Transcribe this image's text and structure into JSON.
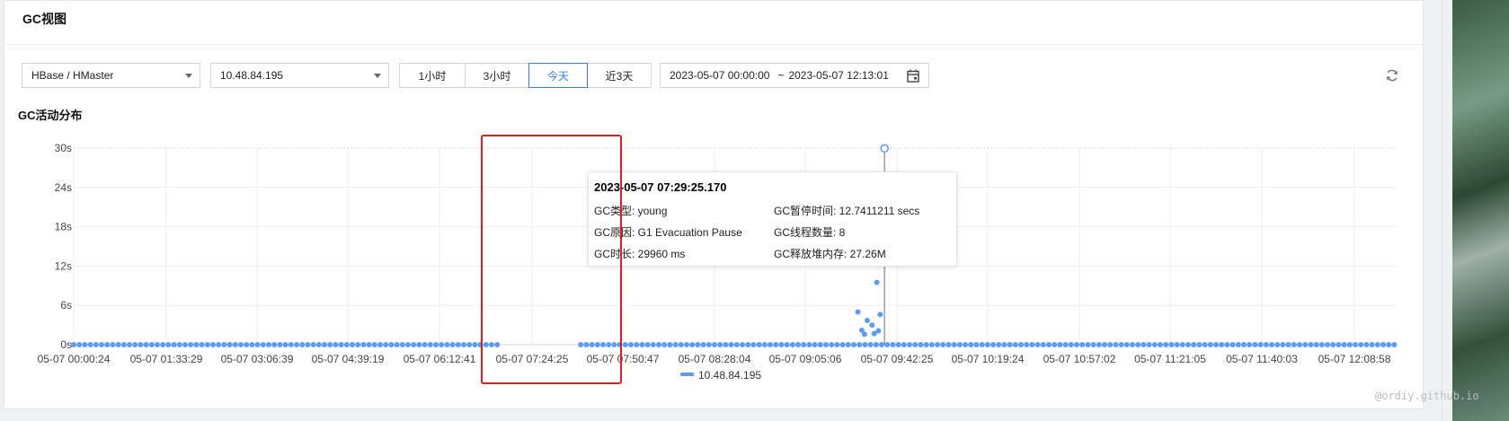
{
  "panel": {
    "title": "GC视图"
  },
  "filters": {
    "service": "HBase / HMaster",
    "instance": "10.48.84.195",
    "time_ranges": [
      {
        "label": "1小时",
        "active": false
      },
      {
        "label": "3小时",
        "active": false
      },
      {
        "label": "今天",
        "active": true
      },
      {
        "label": "近3天",
        "active": false
      }
    ],
    "date_start": "2023-05-07 00:00:00",
    "date_sep": "~",
    "date_end": "2023-05-07 12:13:01",
    "calendar_icon": "calendar-icon",
    "refresh_icon": "refresh-icon"
  },
  "section": {
    "title": "GC活动分布"
  },
  "colors": {
    "accent": "#2f7ef7",
    "series": "#5b9cf5",
    "highlight": "#e51c1c"
  },
  "chart_data": {
    "type": "scatter",
    "title": "GC活动分布",
    "xlabel": "",
    "ylabel": "",
    "y_unit": "s",
    "ylim": [
      0,
      30
    ],
    "y_ticks": [
      "0s",
      "6s",
      "12s",
      "18s",
      "24s",
      "30s"
    ],
    "x_start": "05-07 00:00:24",
    "x_end": "05-07 12:13:01",
    "x_ticks": [
      "05-07 00:00:24",
      "05-07 01:33:29",
      "05-07 03:06:39",
      "05-07 04:39:19",
      "05-07 06:12:41",
      "05-07 07:24:25",
      "05-07 07:50:47",
      "05-07 08:28:04",
      "05-07 09:05:06",
      "05-07 09:42:25",
      "05-07 10:19:24",
      "05-07 10:57:02",
      "05-07 11:21:05",
      "05-07 11:40:03",
      "05-07 12:08:58"
    ],
    "legend": "10.48.84.195",
    "legend_position": "bottom",
    "grid": true,
    "baseline": {
      "y": 0,
      "from": "05-07 00:00:24",
      "to": "05-07 12:13:01"
    },
    "series": [
      {
        "name": "10.48.84.195",
        "points": [
          {
            "x": "05-07 07:14:40",
            "y": 5.0
          },
          {
            "x": "05-07 07:16:50",
            "y": 2.2
          },
          {
            "x": "05-07 07:18:20",
            "y": 1.6
          },
          {
            "x": "05-07 07:19:50",
            "y": 3.7
          },
          {
            "x": "05-07 07:20:50",
            "y": 13.6
          },
          {
            "x": "05-07 07:21:40",
            "y": 22.5
          },
          {
            "x": "05-07 07:22:30",
            "y": 3.0
          },
          {
            "x": "05-07 07:23:40",
            "y": 1.7
          },
          {
            "x": "05-07 07:24:25",
            "y": 16.0
          },
          {
            "x": "05-07 07:25:10",
            "y": 9.5
          },
          {
            "x": "05-07 07:26:00",
            "y": 2.1
          },
          {
            "x": "05-07 07:27:00",
            "y": 4.6
          },
          {
            "x": "05-07 07:29:25",
            "y": 29.96
          },
          {
            "x": "05-07 07:31:20",
            "y": 18.7
          }
        ]
      }
    ]
  },
  "tooltip": {
    "time": "2023-05-07 07:29:25.170",
    "gc_type": "GC类型: young",
    "gc_cause": "GC原因: G1 Evacuation Pause",
    "gc_duration": "GC时长: 29960 ms",
    "gc_pause": "GC暂停时间: 12.7411211 secs",
    "gc_threads": "GC线程数量: 8",
    "gc_freed": "GC释放堆内存: 27.26M"
  },
  "watermark": "@ordiy.github.io"
}
